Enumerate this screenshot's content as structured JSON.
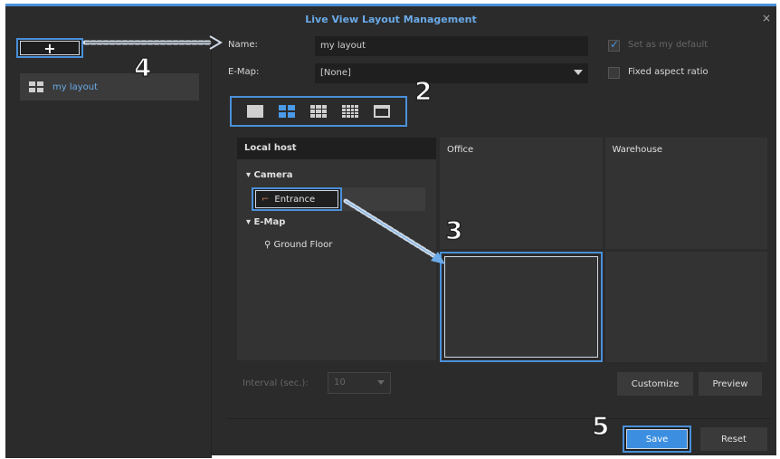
{
  "window": {
    "title": "Live View Layout Management",
    "close_icon": "×"
  },
  "sidebar": {
    "add_label": "+",
    "items": [
      {
        "label": "my layout"
      }
    ]
  },
  "form": {
    "name_label": "Name:",
    "name_value": "my layout",
    "emap_label": "E-Map:",
    "emap_value": "[None]",
    "default_label": "Set as my default",
    "default_checked": true,
    "aspect_label": "Fixed aspect ratio",
    "aspect_checked": false
  },
  "tree": {
    "header": "Local host",
    "camera_group": "Camera",
    "camera_item": "Entrance",
    "emap_group": "E-Map",
    "emap_item": "Ground Floor"
  },
  "grid": {
    "cells": [
      "Office",
      "Warehouse",
      "",
      ""
    ]
  },
  "controls": {
    "interval_label": "Interval (sec.):",
    "interval_value": "10",
    "customize": "Customize",
    "preview": "Preview",
    "save": "Save",
    "reset": "Reset"
  },
  "steps": [
    "4",
    "2",
    "3",
    "5"
  ],
  "colors": {
    "accent": "#4a90d9",
    "background": "#2b2b2b"
  }
}
